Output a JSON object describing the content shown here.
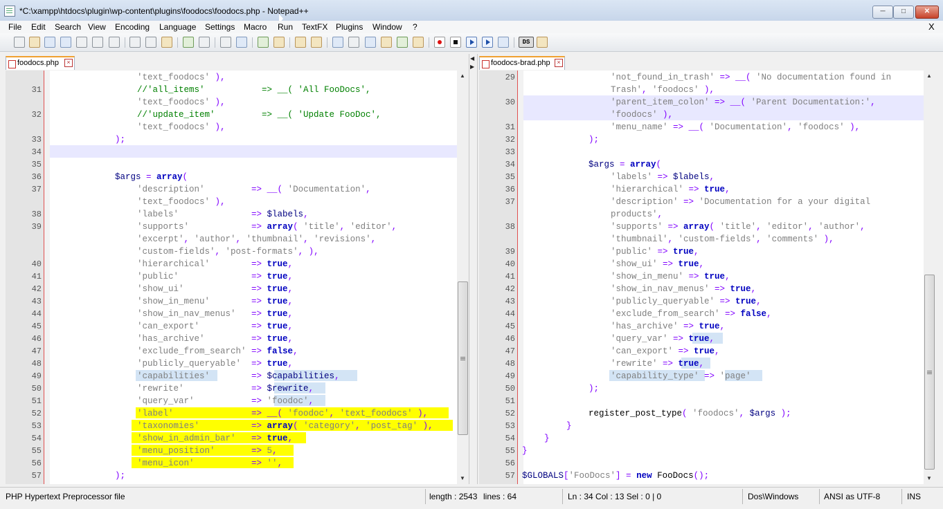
{
  "window": {
    "title": "*C:\\xampp\\htdocs\\plugin\\wp-content\\plugins\\foodocs\\foodocs.php - Notepad++",
    "buttons": {
      "minimize": "─",
      "maximize": "□",
      "close": "✕"
    }
  },
  "menu": {
    "items": [
      "File",
      "Edit",
      "Search",
      "View",
      "Encoding",
      "Language",
      "Settings",
      "Macro",
      "Run",
      "TextFX",
      "Plugins",
      "Window",
      "?"
    ],
    "close_doc": "X"
  },
  "toolbar": {
    "icons": [
      "new-file-icon",
      "open-file-icon",
      "save-icon",
      "save-all-icon",
      "close-icon",
      "close-all-icon",
      "print-icon",
      "cut-icon",
      "copy-icon",
      "paste-icon",
      "undo-icon",
      "redo-icon",
      "find-icon",
      "replace-icon",
      "zoom-in-icon",
      "zoom-out-icon",
      "sync-vertical-icon",
      "sync-horizontal-icon",
      "word-wrap-icon",
      "show-all-chars-icon",
      "indent-guide-icon",
      "user-lang-icon",
      "doc-map-icon",
      "function-list-icon",
      "record-macro-icon",
      "stop-record-icon",
      "play-macro-icon",
      "play-multiple-icon",
      "save-macro-icon",
      "ds-icon",
      "plugin-icon"
    ],
    "ds_label": "DS"
  },
  "left_tab": {
    "label": "foodocs.php"
  },
  "right_tab": {
    "label": "foodocs-brad.php"
  },
  "left_code": [
    {
      "n": "",
      "seg": [
        [
          "st",
          "'text_foodocs'"
        ],
        [
          "op",
          " ),"
        ]
      ]
    },
    {
      "n": "31",
      "seg": [
        [
          "cm",
          "//'all_items'           => __( 'All FooDocs',"
        ]
      ]
    },
    {
      "n": "",
      "seg": [
        [
          "st",
          "'text_foodocs'"
        ],
        [
          "op",
          " ),"
        ]
      ]
    },
    {
      "n": "32",
      "seg": [
        [
          "cm",
          "//'update_item'         => __( 'Update FooDoc',"
        ]
      ]
    },
    {
      "n": "",
      "seg": [
        [
          "st",
          "'text_foodocs'"
        ],
        [
          "op",
          " ),"
        ]
      ]
    },
    {
      "n": "33",
      "seg": [
        [
          "op",
          ");"
        ]
      ]
    },
    {
      "n": "34",
      "seg": []
    },
    {
      "n": "35",
      "seg": []
    },
    {
      "n": "36",
      "seg": [
        [
          "vr",
          "$args"
        ],
        [
          "op",
          " = "
        ],
        [
          "kw",
          "array"
        ],
        [
          "op",
          "("
        ]
      ]
    },
    {
      "n": "37",
      "seg": [
        [
          "st",
          "'description'"
        ],
        [
          "op",
          "         => __( "
        ],
        [
          "st",
          "'Documentation'"
        ],
        [
          "op",
          ","
        ]
      ]
    },
    {
      "n": "",
      "seg": [
        [
          "st",
          "'text_foodocs'"
        ],
        [
          "op",
          " ),"
        ]
      ]
    },
    {
      "n": "38",
      "seg": [
        [
          "st",
          "'labels'"
        ],
        [
          "op",
          "              => "
        ],
        [
          "vr",
          "$labels"
        ],
        [
          "op",
          ","
        ]
      ]
    },
    {
      "n": "39",
      "seg": [
        [
          "st",
          "'supports'"
        ],
        [
          "op",
          "            => "
        ],
        [
          "kw",
          "array"
        ],
        [
          "op",
          "( "
        ],
        [
          "st",
          "'title'"
        ],
        [
          "op",
          ", "
        ],
        [
          "st",
          "'editor'"
        ],
        [
          "op",
          ","
        ]
      ]
    },
    {
      "n": "",
      "seg": [
        [
          "st",
          "'excerpt'"
        ],
        [
          "op",
          ", "
        ],
        [
          "st",
          "'author'"
        ],
        [
          "op",
          ", "
        ],
        [
          "st",
          "'thumbnail'"
        ],
        [
          "op",
          ", "
        ],
        [
          "st",
          "'revisions'"
        ],
        [
          "op",
          ","
        ]
      ]
    },
    {
      "n": "",
      "seg": [
        [
          "st",
          "'custom-fields'"
        ],
        [
          "op",
          ", "
        ],
        [
          "st",
          "'post-formats'"
        ],
        [
          "op",
          ", ),"
        ]
      ]
    },
    {
      "n": "40",
      "seg": [
        [
          "st",
          "'hierarchical'"
        ],
        [
          "op",
          "        => "
        ],
        [
          "kw",
          "true"
        ],
        [
          "op",
          ","
        ]
      ]
    },
    {
      "n": "41",
      "seg": [
        [
          "st",
          "'public'"
        ],
        [
          "op",
          "              => "
        ],
        [
          "kw",
          "true"
        ],
        [
          "op",
          ","
        ]
      ]
    },
    {
      "n": "42",
      "seg": [
        [
          "st",
          "'show_ui'"
        ],
        [
          "op",
          "             => "
        ],
        [
          "kw",
          "true"
        ],
        [
          "op",
          ","
        ]
      ]
    },
    {
      "n": "43",
      "seg": [
        [
          "st",
          "'show_in_menu'"
        ],
        [
          "op",
          "        => "
        ],
        [
          "kw",
          "true"
        ],
        [
          "op",
          ","
        ]
      ]
    },
    {
      "n": "44",
      "seg": [
        [
          "st",
          "'show_in_nav_menus'"
        ],
        [
          "op",
          "   => "
        ],
        [
          "kw",
          "true"
        ],
        [
          "op",
          ","
        ]
      ]
    },
    {
      "n": "45",
      "seg": [
        [
          "st",
          "'can_export'"
        ],
        [
          "op",
          "          => "
        ],
        [
          "kw",
          "true"
        ],
        [
          "op",
          ","
        ]
      ]
    },
    {
      "n": "46",
      "seg": [
        [
          "st",
          "'has_archive'"
        ],
        [
          "op",
          "         => "
        ],
        [
          "kw",
          "true"
        ],
        [
          "op",
          ","
        ]
      ]
    },
    {
      "n": "47",
      "seg": [
        [
          "st",
          "'exclude_from_search'"
        ],
        [
          "op",
          " => "
        ],
        [
          "kw",
          "false"
        ],
        [
          "op",
          ","
        ]
      ]
    },
    {
      "n": "48",
      "seg": [
        [
          "st",
          "'publicly_queryable'"
        ],
        [
          "op",
          "  => "
        ],
        [
          "kw",
          "true"
        ],
        [
          "op",
          ","
        ]
      ]
    },
    {
      "n": "49",
      "seg": [
        [
          "st",
          "'capabilities'"
        ],
        [
          "op",
          "        => "
        ],
        [
          "vr",
          "$capabilities"
        ],
        [
          "op",
          ","
        ]
      ]
    },
    {
      "n": "50",
      "seg": [
        [
          "st",
          "'rewrite'"
        ],
        [
          "op",
          "             => "
        ],
        [
          "vr",
          "$rewrite"
        ],
        [
          "op",
          ","
        ]
      ]
    },
    {
      "n": "51",
      "seg": [
        [
          "st",
          "'query_var'"
        ],
        [
          "op",
          "           => "
        ],
        [
          "st",
          "'foodoc'"
        ],
        [
          "op",
          ","
        ]
      ]
    },
    {
      "n": "52",
      "seg": [
        [
          "st",
          "'label'"
        ],
        [
          "op",
          "               => __( "
        ],
        [
          "st",
          "'foodoc'"
        ],
        [
          "op",
          ", "
        ],
        [
          "st",
          "'text_foodocs'"
        ],
        [
          "op",
          " ),"
        ]
      ]
    },
    {
      "n": "53",
      "seg": [
        [
          "st",
          "'taxonomies'"
        ],
        [
          "op",
          "          => "
        ],
        [
          "kw",
          "array"
        ],
        [
          "op",
          "( "
        ],
        [
          "st",
          "'category'"
        ],
        [
          "op",
          ", "
        ],
        [
          "st",
          "'post_tag'"
        ],
        [
          "op",
          " ),"
        ]
      ]
    },
    {
      "n": "54",
      "seg": [
        [
          "st",
          "'show_in_admin_bar'"
        ],
        [
          "op",
          "   => "
        ],
        [
          "kw",
          "true"
        ],
        [
          "op",
          ","
        ]
      ]
    },
    {
      "n": "55",
      "seg": [
        [
          "st",
          "'menu_position'"
        ],
        [
          "op",
          "       => "
        ],
        [
          "st",
          "5"
        ],
        [
          "op",
          ","
        ]
      ]
    },
    {
      "n": "56",
      "seg": [
        [
          "st",
          "'menu_icon'"
        ],
        [
          "op",
          "           => "
        ],
        [
          "st",
          "''"
        ],
        [
          "op",
          ","
        ]
      ]
    },
    {
      "n": "57",
      "seg": [
        [
          "op",
          ");"
        ]
      ]
    }
  ],
  "right_code": [
    {
      "n": "29",
      "seg": [
        [
          "st",
          "'not_found_in_trash'"
        ],
        [
          "op",
          " => __( "
        ],
        [
          "st",
          "'No documentation found in"
        ]
      ]
    },
    {
      "n": "",
      "seg": [
        [
          "st",
          "Trash'"
        ],
        [
          "op",
          ", "
        ],
        [
          "st",
          "'foodocs'"
        ],
        [
          "op",
          " ),"
        ]
      ]
    },
    {
      "n": "30",
      "seg": [
        [
          "st",
          "'parent_item_colon'"
        ],
        [
          "op",
          " => __( "
        ],
        [
          "st",
          "'Parent Documentation:'"
        ],
        [
          "op",
          ","
        ]
      ]
    },
    {
      "n": "",
      "seg": [
        [
          "st",
          "'foodocs'"
        ],
        [
          "op",
          " ),"
        ]
      ]
    },
    {
      "n": "31",
      "seg": [
        [
          "st",
          "'menu_name'"
        ],
        [
          "op",
          " => __( "
        ],
        [
          "st",
          "'Documentation'"
        ],
        [
          "op",
          ", "
        ],
        [
          "st",
          "'foodocs'"
        ],
        [
          "op",
          " ),"
        ]
      ]
    },
    {
      "n": "32",
      "seg": [
        [
          "op",
          ");"
        ]
      ]
    },
    {
      "n": "33",
      "seg": []
    },
    {
      "n": "34",
      "seg": [
        [
          "vr",
          "$args"
        ],
        [
          "op",
          " = "
        ],
        [
          "kw",
          "array"
        ],
        [
          "op",
          "("
        ]
      ]
    },
    {
      "n": "35",
      "seg": [
        [
          "st",
          "'labels'"
        ],
        [
          "op",
          " => "
        ],
        [
          "vr",
          "$labels"
        ],
        [
          "op",
          ","
        ]
      ]
    },
    {
      "n": "36",
      "seg": [
        [
          "st",
          "'hierarchical'"
        ],
        [
          "op",
          " => "
        ],
        [
          "kw",
          "true"
        ],
        [
          "op",
          ","
        ]
      ]
    },
    {
      "n": "37",
      "seg": [
        [
          "st",
          "'description'"
        ],
        [
          "op",
          " => "
        ],
        [
          "st",
          "'Documentation for a your digital"
        ]
      ]
    },
    {
      "n": "",
      "seg": [
        [
          "st",
          "products'"
        ],
        [
          "op",
          ","
        ]
      ]
    },
    {
      "n": "38",
      "seg": [
        [
          "st",
          "'supports'"
        ],
        [
          "op",
          " => "
        ],
        [
          "kw",
          "array"
        ],
        [
          "op",
          "( "
        ],
        [
          "st",
          "'title'"
        ],
        [
          "op",
          ", "
        ],
        [
          "st",
          "'editor'"
        ],
        [
          "op",
          ", "
        ],
        [
          "st",
          "'author'"
        ],
        [
          "op",
          ","
        ]
      ]
    },
    {
      "n": "",
      "seg": [
        [
          "st",
          "'thumbnail'"
        ],
        [
          "op",
          ", "
        ],
        [
          "st",
          "'custom-fields'"
        ],
        [
          "op",
          ", "
        ],
        [
          "st",
          "'comments'"
        ],
        [
          "op",
          " ),"
        ]
      ]
    },
    {
      "n": "39",
      "seg": [
        [
          "st",
          "'public'"
        ],
        [
          "op",
          " => "
        ],
        [
          "kw",
          "true"
        ],
        [
          "op",
          ","
        ]
      ]
    },
    {
      "n": "40",
      "seg": [
        [
          "st",
          "'show_ui'"
        ],
        [
          "op",
          " => "
        ],
        [
          "kw",
          "true"
        ],
        [
          "op",
          ","
        ]
      ]
    },
    {
      "n": "41",
      "seg": [
        [
          "st",
          "'show_in_menu'"
        ],
        [
          "op",
          " => "
        ],
        [
          "kw",
          "true"
        ],
        [
          "op",
          ","
        ]
      ]
    },
    {
      "n": "42",
      "seg": [
        [
          "st",
          "'show_in_nav_menus'"
        ],
        [
          "op",
          " => "
        ],
        [
          "kw",
          "true"
        ],
        [
          "op",
          ","
        ]
      ]
    },
    {
      "n": "43",
      "seg": [
        [
          "st",
          "'publicly_queryable'"
        ],
        [
          "op",
          " => "
        ],
        [
          "kw",
          "true"
        ],
        [
          "op",
          ","
        ]
      ]
    },
    {
      "n": "44",
      "seg": [
        [
          "st",
          "'exclude_from_search'"
        ],
        [
          "op",
          " => "
        ],
        [
          "kw",
          "false"
        ],
        [
          "op",
          ","
        ]
      ]
    },
    {
      "n": "45",
      "seg": [
        [
          "st",
          "'has_archive'"
        ],
        [
          "op",
          " => "
        ],
        [
          "kw",
          "true"
        ],
        [
          "op",
          ","
        ]
      ]
    },
    {
      "n": "46",
      "seg": [
        [
          "st",
          "'query_var'"
        ],
        [
          "op",
          " => "
        ],
        [
          "kw",
          "true"
        ],
        [
          "op",
          ","
        ]
      ]
    },
    {
      "n": "47",
      "seg": [
        [
          "st",
          "'can_export'"
        ],
        [
          "op",
          " => "
        ],
        [
          "kw",
          "true"
        ],
        [
          "op",
          ","
        ]
      ]
    },
    {
      "n": "48",
      "seg": [
        [
          "st",
          "'rewrite'"
        ],
        [
          "op",
          " => "
        ],
        [
          "kw",
          "true"
        ],
        [
          "op",
          ","
        ]
      ]
    },
    {
      "n": "49",
      "seg": [
        [
          "st",
          "'capability_type'"
        ],
        [
          "op",
          " => "
        ],
        [
          "st",
          "'page'"
        ]
      ]
    },
    {
      "n": "50",
      "seg": [
        [
          "op",
          ");"
        ]
      ]
    },
    {
      "n": "51",
      "seg": []
    },
    {
      "n": "52",
      "seg": [
        [
          "fn",
          "register_post_type"
        ],
        [
          "op",
          "( "
        ],
        [
          "st",
          "'foodocs'"
        ],
        [
          "op",
          ", "
        ],
        [
          "vr",
          "$args"
        ],
        [
          "op",
          " );"
        ]
      ]
    },
    {
      "n": "53",
      "seg": [
        [
          "op",
          "}"
        ]
      ]
    },
    {
      "n": "54",
      "seg": [
        [
          "op",
          "}"
        ]
      ]
    },
    {
      "n": "55",
      "seg": [
        [
          "op",
          "}"
        ]
      ]
    },
    {
      "n": "56",
      "seg": []
    },
    {
      "n": "57",
      "seg": [
        [
          "vr",
          "$GLOBALS"
        ],
        [
          "op",
          "["
        ],
        [
          "st",
          "'FooDocs'"
        ],
        [
          "op",
          "] = "
        ],
        [
          "kw",
          "new"
        ],
        [
          "fn",
          " FooDocs"
        ],
        [
          "op",
          "();"
        ]
      ]
    }
  ],
  "status": {
    "file_type": "PHP Hypertext Preprocessor file",
    "length": "length : 2543",
    "lines": "lines : 64",
    "position": "Ln : 34    Col : 13    Sel : 0 | 0",
    "eol": "Dos\\Windows",
    "encoding": "ANSI as UTF-8",
    "mode": "INS"
  }
}
